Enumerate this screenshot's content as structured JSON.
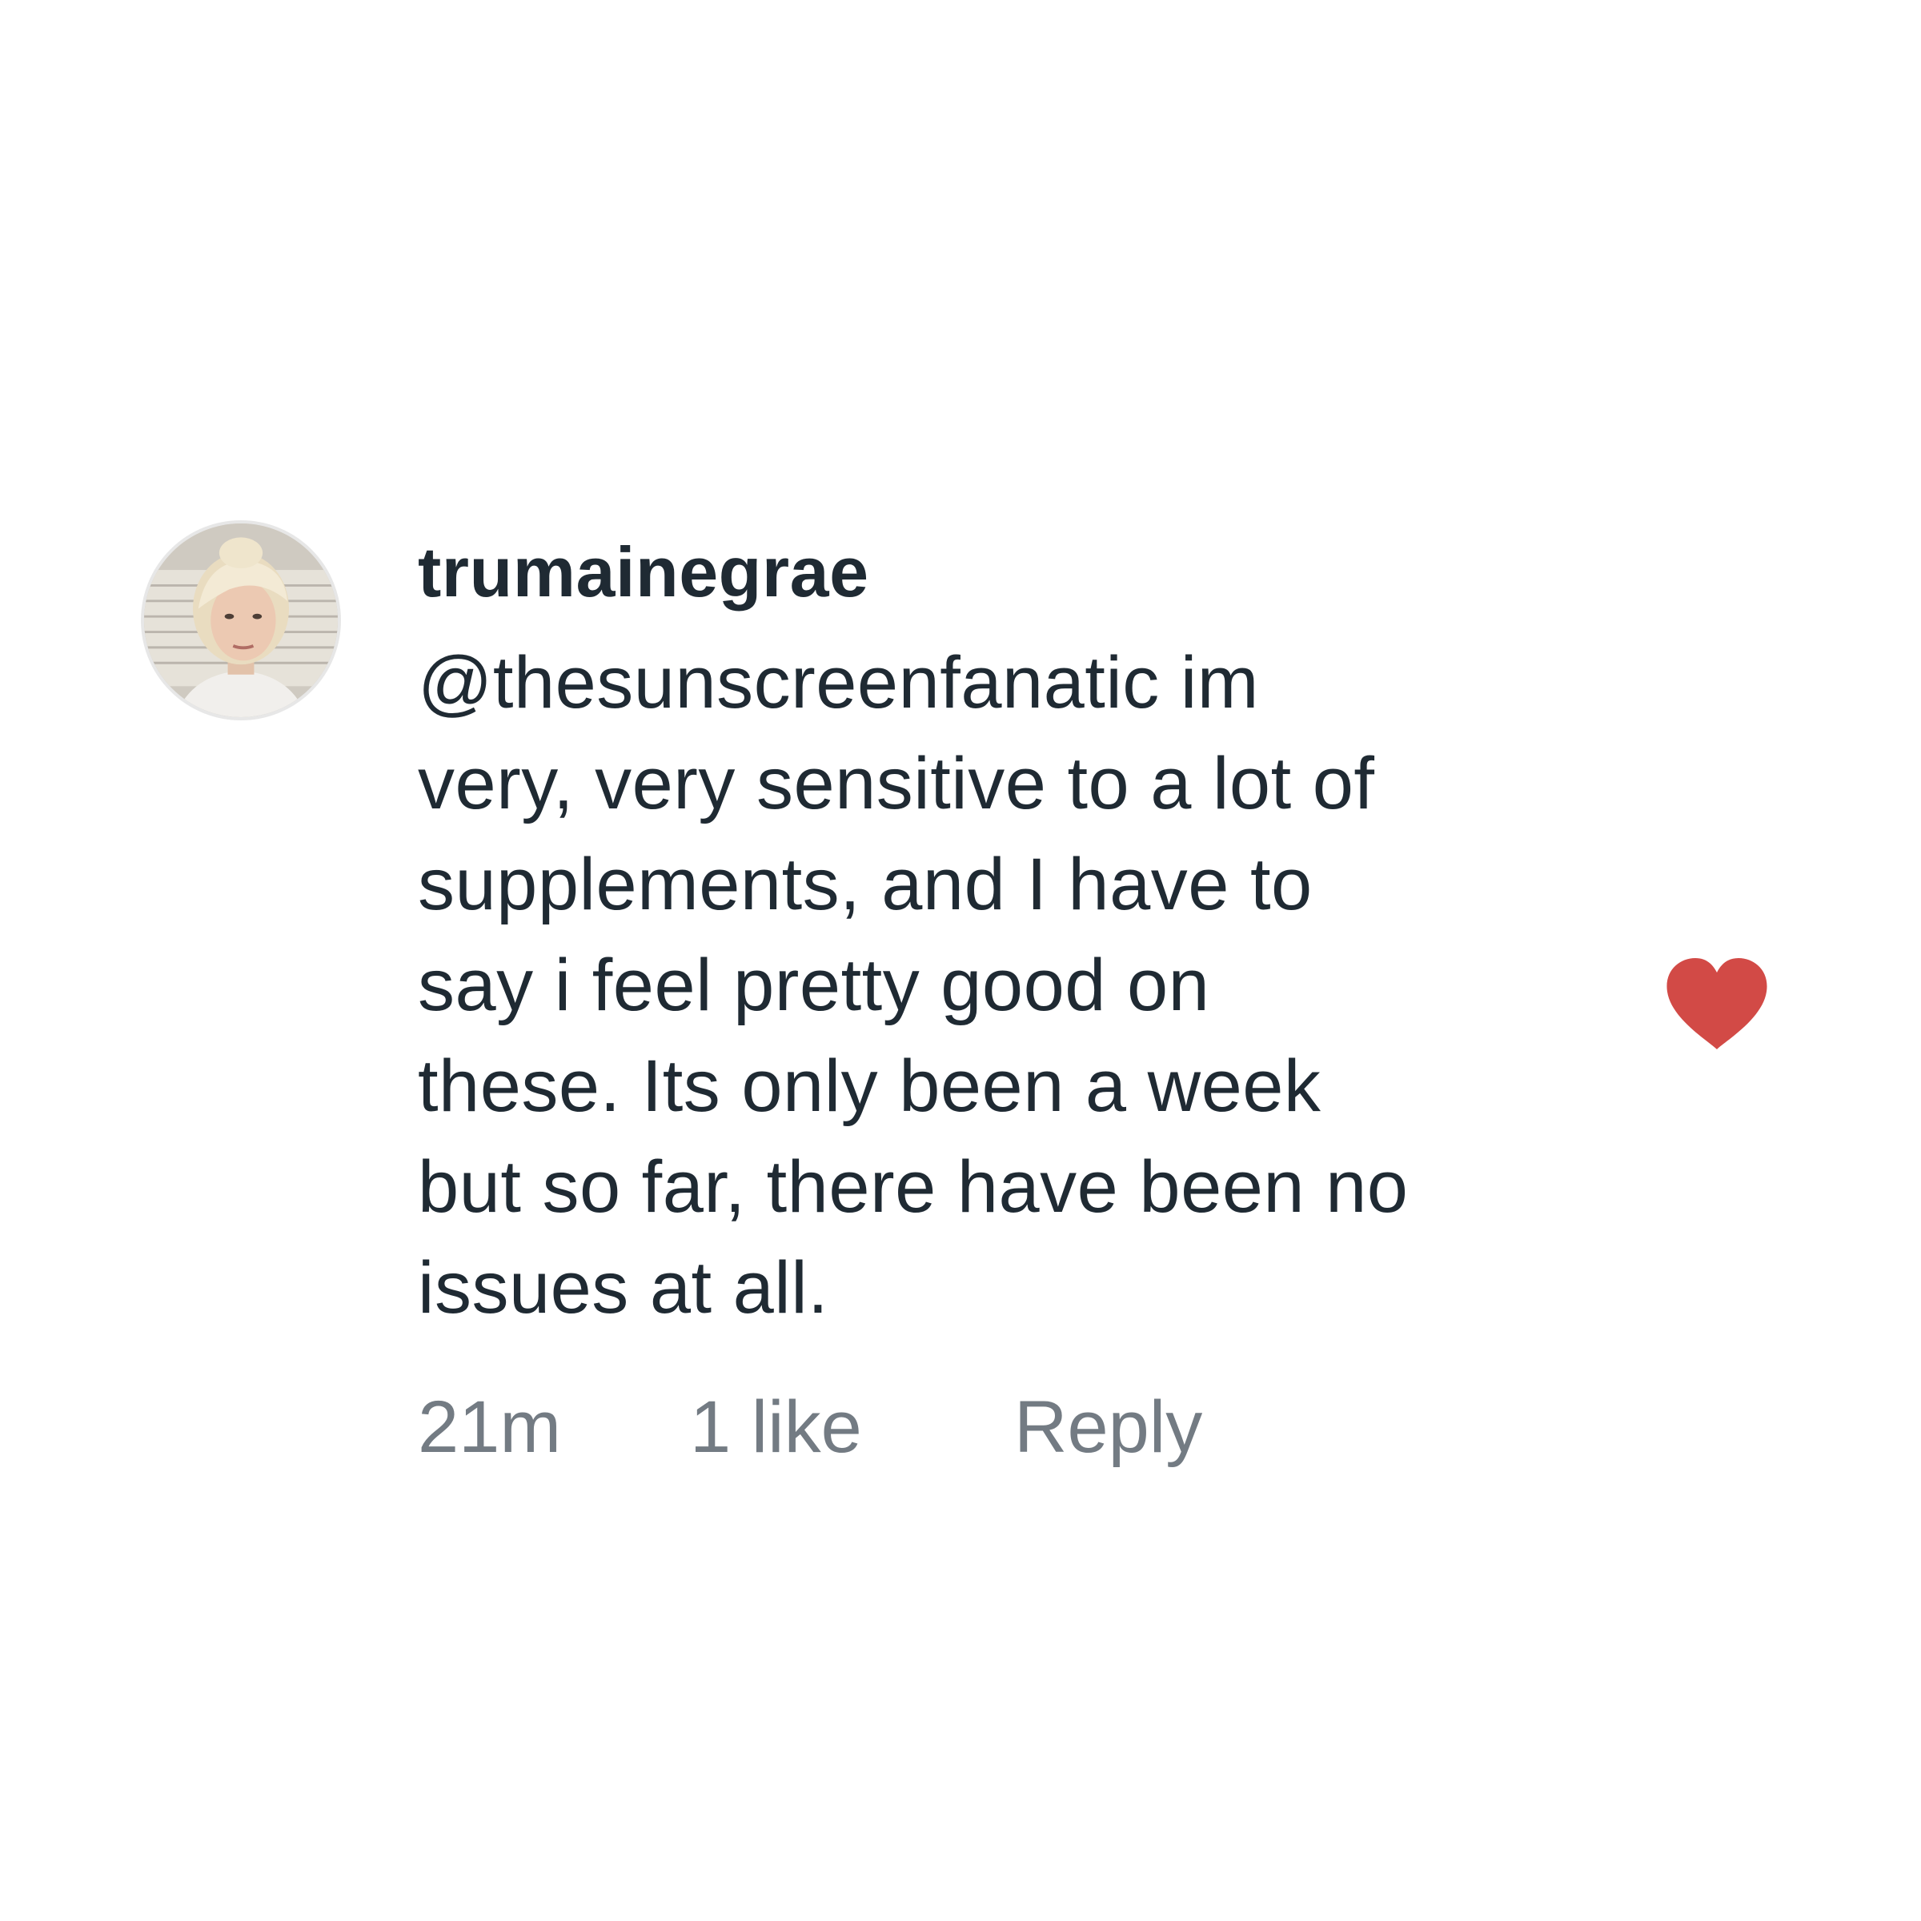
{
  "comment": {
    "avatar_icon": "user-avatar-photo",
    "username": "trumainegrae",
    "text_lines": [
      "@thesunscreenfanatic im",
      "very, very sensitive to a lot of",
      "supplements, and I have to",
      "say i feel pretty good on",
      "these. Its only been a week",
      "but so far, there have been no",
      "issues at all."
    ],
    "timestamp": "21m",
    "likes": "1 like",
    "reply_label": "Reply",
    "like_icon": "heart-icon",
    "colors": {
      "text": "#1f2a33",
      "meta": "#737b83",
      "heart": "#d24a46",
      "background": "#ffffff"
    }
  }
}
